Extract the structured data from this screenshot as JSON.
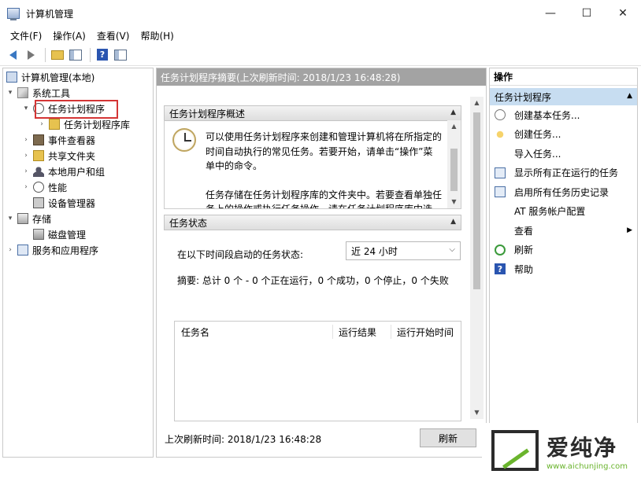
{
  "window": {
    "title": "计算机管理",
    "minimize": "—",
    "maximize": "☐",
    "close": "✕"
  },
  "menu": [
    "文件(F)",
    "操作(A)",
    "查看(V)",
    "帮助(H)"
  ],
  "tree": {
    "root": "计算机管理(本地)",
    "system_tools": "系统工具",
    "task_scheduler": "任务计划程序",
    "task_library": "任务计划程序库",
    "event_viewer": "事件查看器",
    "shared_folders": "共享文件夹",
    "local_users": "本地用户和组",
    "performance": "性能",
    "device_manager": "设备管理器",
    "storage": "存储",
    "disk_management": "磁盘管理",
    "services": "服务和应用程序"
  },
  "main": {
    "header": "任务计划程序摘要(上次刷新时间: 2018/1/23 16:48:28)",
    "overview_title": "任务计划程序概述",
    "overview_para1": "可以使用任务计划程序来创建和管理计算机将在所指定的时间自动执行的常见任务。若要开始，请单击“操作”菜单中的命令。",
    "overview_para2": "任务存储在任务计划程序库的文件夹中。若要查看单独任务上的操作或执行任务操作，请在任务计划程序库中选",
    "status_title": "任务状态",
    "status_label": "在以下时间段启动的任务状态:",
    "status_period": "近 24 小时",
    "summary": "摘要: 总计 0 个 - 0 个正在运行，0 个成功，0 个停止，0 个失败",
    "columns": [
      "任务名",
      "运行结果",
      "运行开始时间"
    ],
    "last_refresh": "上次刷新时间: 2018/1/23 16:48:28",
    "refresh_button": "刷新"
  },
  "actions": {
    "header": "操作",
    "section": "任务计划程序",
    "items": [
      "创建基本任务...",
      "创建任务...",
      "导入任务...",
      "显示所有正在运行的任务",
      "启用所有任务历史记录",
      "AT 服务帐户配置",
      "查看",
      "刷新",
      "帮助"
    ]
  },
  "watermark": {
    "main": "爱纯净",
    "url": "www.aichunjing.com"
  }
}
